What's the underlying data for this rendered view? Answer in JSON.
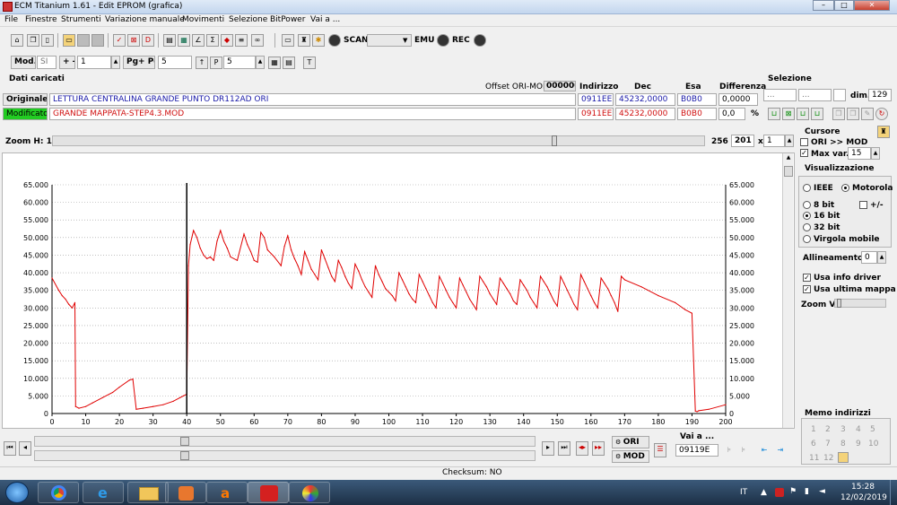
{
  "window": {
    "title": "ECM Titanium 1.61 - Edit EPROM (grafica)",
    "min": "–",
    "max": "□",
    "close": "✕"
  },
  "menu": [
    "File",
    "Finestre",
    "Strumenti",
    "Variazione manuale",
    "Movimenti",
    "Selezione",
    "BitPower",
    "Vai a ..."
  ],
  "toolbar1": {
    "scan_label": "SCAN",
    "emu_label": "EMU",
    "rec_label": "REC"
  },
  "toolbar2": {
    "mod_label": "Mod.:",
    "mod_value": "SI",
    "plusminus": "+ -",
    "step_value": "1",
    "pg_label": "Pg+ Pg-",
    "pg_value": "5",
    "p_value": "5"
  },
  "data_loaded": {
    "header": "Dati caricati",
    "offset_label": "Offset ORI-MOD",
    "offset_value": "000000",
    "col_indirizzo": "Indirizzo",
    "col_dec": "Dec",
    "col_esa": "Esa",
    "col_diff": "Differenza",
    "original": {
      "label": "Originale",
      "name": "LETTURA CENTRALINA GRANDE PUNTO DR112AD ORI",
      "addr": "0911EE",
      "dec": "45232,0000",
      "esa": "B0B0",
      "diff": "0,0000"
    },
    "modified": {
      "label": "Modificato",
      "name": "GRANDE MAPPATA-STEP4.3.MOD",
      "addr": "0911EE",
      "dec": "45232,0000",
      "esa": "B0B0",
      "diff": "0,0",
      "pct": "%"
    }
  },
  "selezione": {
    "label": "Selezione",
    "from": "...",
    "to": "...",
    "dim_label": "dim.",
    "dim_value": "129"
  },
  "zoom": {
    "label": "Zoom H: 16",
    "right_value": "256",
    "value": "201",
    "x_label": "x",
    "mult": "1"
  },
  "cursore": {
    "label": "Cursore",
    "ori_mod": "ORI >> MOD",
    "max_var": "Max var.",
    "max_var_value": "15"
  },
  "visualizzazione": {
    "label": "Visualizzazione",
    "ieee": "IEEE",
    "motorola": "Motorola",
    "bit8": "8 bit",
    "plusminus": "+/-",
    "bit16": "16 bit",
    "bit32": "32 bit",
    "float": "Virgola mobile",
    "align_label": "Allineamento:",
    "align_value": "0",
    "info_driver": "Usa info driver",
    "last_map": "Usa ultima mappa",
    "zoom_v": "Zoom V:"
  },
  "memo": {
    "label": "Memo indirizzi",
    "slots": [
      "1",
      "2",
      "3",
      "4",
      "5",
      "6",
      "7",
      "8",
      "9",
      "10",
      "11",
      "12"
    ]
  },
  "nav": {
    "ori_label": "ORI",
    "mod_label": "MOD",
    "vai_label": "Vai a ...",
    "vai_value": "09119E"
  },
  "status": {
    "checksum": "Checksum: NO"
  },
  "tray": {
    "lang": "IT",
    "time": "15:28",
    "date": "12/02/2019"
  },
  "colors": {
    "line": "#e00000",
    "cursor": "#000000",
    "accent_green": "#22cc22"
  },
  "chart_data": {
    "type": "line",
    "xlim": [
      0,
      200
    ],
    "ylim": [
      0,
      65000
    ],
    "xticks": [
      "0",
      "10",
      "20",
      "30",
      "40",
      "50",
      "60",
      "70",
      "80",
      "90",
      "100",
      "110",
      "120",
      "130",
      "140",
      "150",
      "160",
      "170",
      "180",
      "190",
      "200"
    ],
    "yticks": [
      "0",
      "5.000",
      "10.000",
      "15.000",
      "20.000",
      "25.000",
      "30.000",
      "35.000",
      "40.000",
      "45.000",
      "50.000",
      "55.000",
      "60.000",
      "65.000"
    ],
    "cursor_x": 40,
    "grid": "horizontal dashed",
    "x": [
      0,
      2,
      3,
      4,
      5,
      6,
      6.8,
      7,
      8,
      10,
      12,
      15,
      18,
      20,
      23,
      24,
      25,
      27,
      30,
      33,
      36,
      38,
      39,
      40,
      40.5,
      41,
      42,
      43,
      44,
      45,
      46,
      47,
      48,
      49,
      50,
      51,
      52,
      53,
      55,
      57,
      58,
      59,
      60,
      61,
      62,
      63,
      64,
      66,
      68,
      69,
      70,
      71,
      72,
      73,
      74,
      75,
      76,
      77,
      78,
      79,
      80,
      81,
      82,
      83,
      84,
      85,
      86,
      87,
      88,
      89,
      90,
      91,
      92,
      93,
      94,
      95,
      96,
      97,
      98,
      99,
      100,
      101,
      102,
      103,
      104,
      105,
      106,
      107,
      108,
      109,
      110,
      111,
      112,
      113,
      114,
      115,
      116,
      117,
      118,
      119,
      120,
      121,
      122,
      123,
      124,
      125,
      126,
      127,
      128,
      129,
      130,
      131,
      132,
      133,
      134,
      135,
      136,
      137,
      138,
      139,
      140,
      141,
      142,
      143,
      144,
      145,
      146,
      147,
      148,
      149,
      150,
      151,
      152,
      153,
      154,
      155,
      156,
      157,
      158,
      159,
      160,
      161,
      162,
      163,
      164,
      165,
      166,
      167,
      168,
      169,
      170,
      175,
      180,
      185,
      188,
      190,
      191,
      191.5,
      192,
      195,
      200
    ],
    "y": [
      38500,
      35000,
      33500,
      32500,
      31000,
      30000,
      31500,
      2000,
      1500,
      2000,
      3000,
      4500,
      6000,
      7500,
      9500,
      9800,
      1200,
      1500,
      2000,
      2500,
      3500,
      4500,
      5000,
      5500,
      42000,
      48000,
      52000,
      50000,
      47000,
      45000,
      44000,
      44500,
      43500,
      49000,
      52000,
      49000,
      47000,
      44500,
      43500,
      51000,
      48000,
      46000,
      43500,
      43000,
      51500,
      50000,
      46500,
      44500,
      42000,
      47500,
      50500,
      46500,
      44000,
      42000,
      39500,
      46000,
      43500,
      41000,
      39500,
      38000,
      46500,
      44000,
      41500,
      39000,
      37500,
      43500,
      41500,
      39000,
      37000,
      35500,
      42500,
      40500,
      38000,
      36000,
      34500,
      33000,
      42000,
      39500,
      37500,
      35500,
      34500,
      33500,
      32000,
      40000,
      38000,
      36000,
      34000,
      32500,
      31500,
      39500,
      37500,
      35500,
      33500,
      31500,
      30000,
      39000,
      37000,
      35000,
      33000,
      31500,
      30000,
      38500,
      36500,
      34500,
      32500,
      31000,
      29500,
      39000,
      37500,
      36000,
      34000,
      32500,
      31000,
      38500,
      37000,
      35500,
      34000,
      32000,
      31000,
      38000,
      36500,
      35000,
      33000,
      31500,
      30000,
      39000,
      37500,
      36000,
      34000,
      32000,
      30500,
      39000,
      37000,
      35000,
      33000,
      31000,
      29500,
      39500,
      37500,
      35500,
      33500,
      31500,
      30000,
      38500,
      37000,
      35500,
      33500,
      31500,
      29000,
      39000,
      38000,
      36000,
      33500,
      31500,
      29500,
      28500,
      700,
      500,
      800,
      1200,
      2500,
      3500,
      5000,
      5800,
      1500,
      500,
      400,
      400
    ]
  }
}
